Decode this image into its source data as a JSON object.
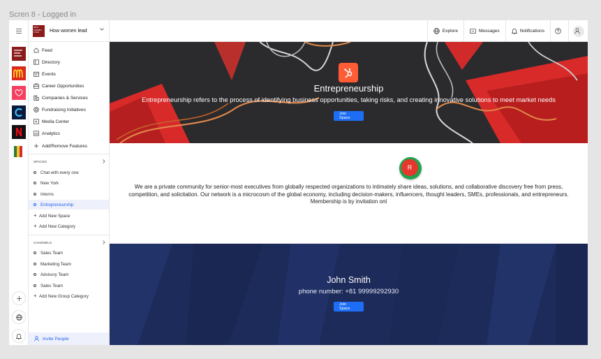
{
  "frame_label": "Scren 8 - Logged in",
  "brand": {
    "logo_text": "HOW WOMEN LEAD",
    "name": "How women lead"
  },
  "topnav": {
    "explore": "Explore",
    "messages": "Messages",
    "notifications": "Notifications"
  },
  "rail_apps": [
    {
      "icon": "how-women-lead-logo",
      "color": "#8b1a1a"
    },
    {
      "icon": "mcdonalds-logo",
      "color": "#da291c"
    },
    {
      "icon": "heart-app-logo",
      "color": "#f43f5e"
    },
    {
      "icon": "c-app-logo",
      "color": "#0b1a3a"
    },
    {
      "icon": "netflix-logo",
      "color": "#111111"
    },
    {
      "icon": "flag-logo",
      "color": "#2e7d32"
    }
  ],
  "sidebar": {
    "main": [
      {
        "label": "Feed",
        "icon": "home-icon"
      },
      {
        "label": "Directory",
        "icon": "directory-icon"
      },
      {
        "label": "Events",
        "icon": "events-icon"
      },
      {
        "label": "Career Opportunities",
        "icon": "briefcase-icon"
      },
      {
        "label": "Companies & Services",
        "icon": "building-icon"
      },
      {
        "label": "Fundraising Initiatives",
        "icon": "fundraising-icon"
      },
      {
        "label": "Media Center",
        "icon": "media-icon"
      },
      {
        "label": "Analytics",
        "icon": "analytics-icon"
      },
      {
        "label": "Add/Remove Features",
        "icon": "plus-icon"
      }
    ],
    "spaces_heading": "SPACES",
    "spaces": [
      "Chat with every one",
      "New York",
      "Interns",
      "Entrepreneurship"
    ],
    "spaces_active": "Entrepreneurship",
    "add_space": "Add New Space",
    "add_category": "Add New Category",
    "channels_heading": "CHANNELS",
    "channels": [
      "Sales Team",
      "Marketing Team",
      "Advisory Team",
      "Sales Team"
    ],
    "add_group_category": "Add New Group Category",
    "invite": "Invite People"
  },
  "hero": {
    "title": "Entrepreneurship",
    "description": "Entrepreneurship refers to the process of identifying business opportunities, taking risks, and creating innovative solutions to meet market needs",
    "button": "Join Space",
    "icon": "hubspot-icon",
    "icon_color": "#ff5c35"
  },
  "about": {
    "avatar_letter": "R",
    "text": "We are a private community for senior-most executives from globally respected organizations to intimately share ideas, solutions, and collaborative discovery free from press, competition, and solicitation. Our network is a microcosm of the global economy, including decision-makers, influencers, thought leaders, SMEs, professionals, and entrepreneurs. Membership is by invitation onl"
  },
  "profile": {
    "name": "John Smith",
    "phone": "phone number: +81 99999292930",
    "button": "Join Space"
  }
}
